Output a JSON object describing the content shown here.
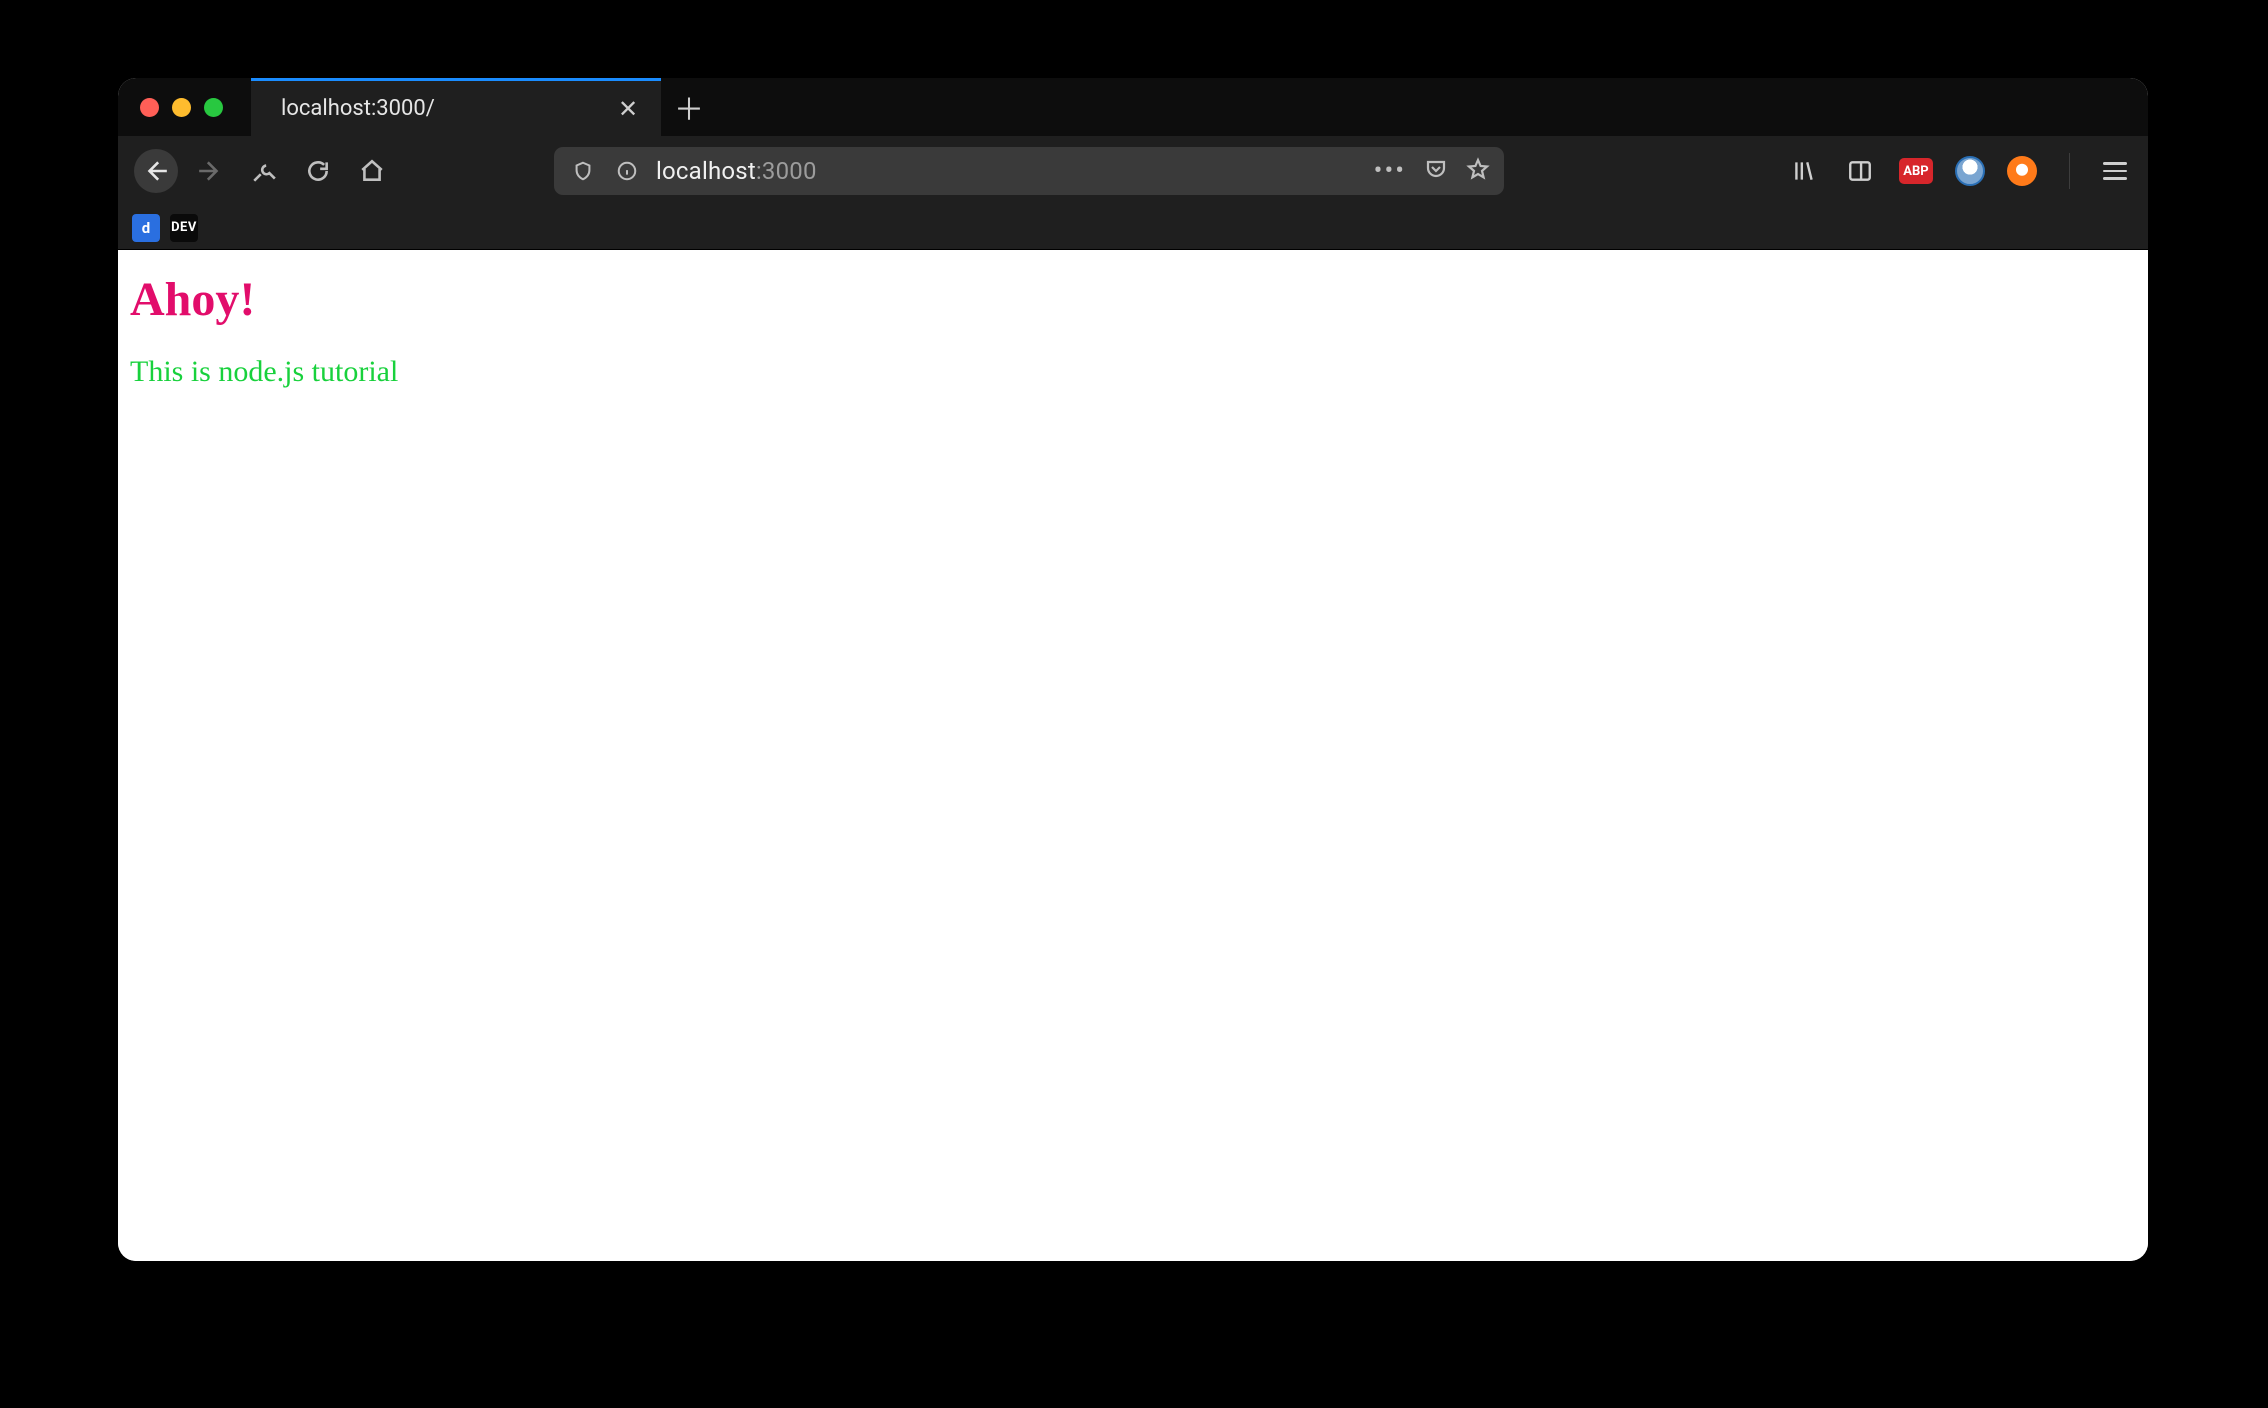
{
  "tab": {
    "title": "localhost:3000/"
  },
  "address": {
    "host": "localhost",
    "port_suffix": ":3000"
  },
  "bookmarks": {
    "devto_label": "DEV",
    "blue_label": "d"
  },
  "extensions": {
    "abp_label": "ABP"
  },
  "page": {
    "heading": "Ahoy!",
    "paragraph": "This is node.js tutorial"
  }
}
